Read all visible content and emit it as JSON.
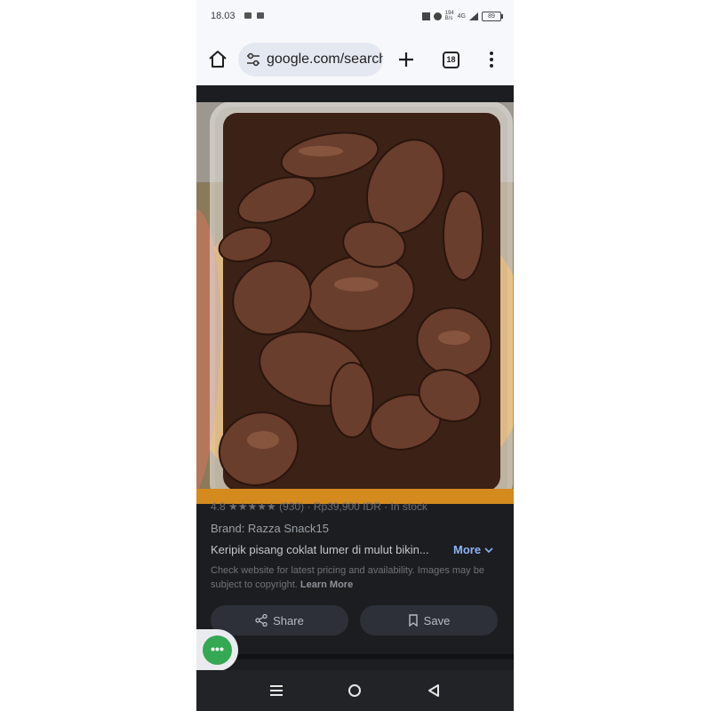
{
  "status_bar": {
    "time": "18.03",
    "network_speed": "194 B/s",
    "network_type": "4G",
    "battery": "89"
  },
  "toolbar": {
    "url": "google.com/search?q=keripik",
    "tab_count": "18"
  },
  "product": {
    "meta_line": "4.8 ★★★★★ (930) · Rp39,900 IDR · In stock",
    "brand": "Brand: Razza Snack15",
    "description": "Keripik pisang coklat lumer di mulut bikin...",
    "more_label": "More",
    "disclaimer": "Check website for latest pricing and availability. Images may be subject to copyright.",
    "learn_more": "Learn More"
  },
  "actions": {
    "share_label": "Share",
    "save_label": "Save"
  },
  "chat_bubble": {
    "label": "•••"
  },
  "colors": {
    "accent_green": "#34a853",
    "link_blue": "#8ab4f8",
    "page_dark": "#1c1d21"
  },
  "icons": [
    "home-icon",
    "tune-icon",
    "plus-icon",
    "tabs-icon",
    "more-vert-icon",
    "share-icon",
    "bookmark-icon",
    "recent-apps-icon",
    "home-circle-icon",
    "back-icon"
  ]
}
